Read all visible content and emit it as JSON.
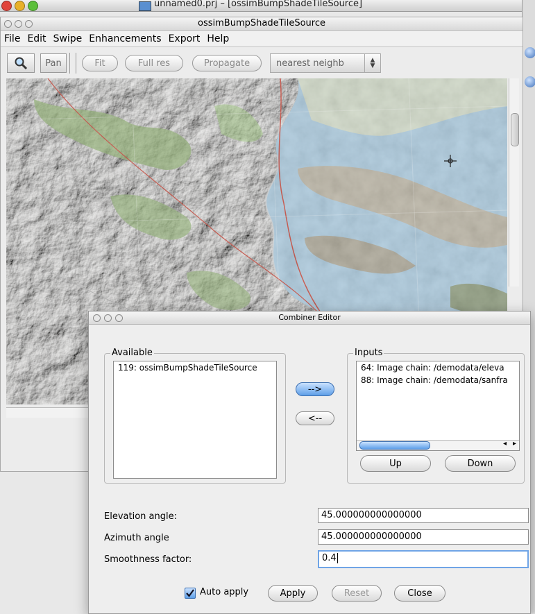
{
  "outer_window": {
    "title": "unnamed0.prj – [ossimBumpShadeTileSource]"
  },
  "main_window": {
    "title": "ossimBumpShadeTileSource",
    "menu": [
      "File",
      "Edit",
      "Swipe",
      "Enhancements",
      "Export",
      "Help"
    ],
    "toolbar": {
      "pan_label": "Pan",
      "fit_label": "Fit",
      "fullres_label": "Full res",
      "propagate_label": "Propagate",
      "resample_value": "nearest neighb"
    }
  },
  "dialog": {
    "title": "Combiner Editor",
    "available": {
      "label": "Available",
      "items": [
        "119: ossimBumpShadeTileSource"
      ]
    },
    "add_button": "-->",
    "remove_button": "<--",
    "inputs": {
      "label": "Inputs",
      "items": [
        "64: Image chain: /demodata/eleva",
        "88: Image chain: /demodata/sanfra"
      ]
    },
    "up_button": "Up",
    "down_button": "Down",
    "fields": [
      {
        "label": "Elevation angle:",
        "value": "45.000000000000000"
      },
      {
        "label": "Azimuth angle",
        "value": "45.000000000000000"
      },
      {
        "label": "Smoothness factor:",
        "value": "0.4"
      }
    ],
    "auto_apply_label": "Auto apply",
    "auto_apply_checked": true,
    "apply_button": "Apply",
    "reset_button": "Reset",
    "close_button": "Close"
  },
  "colors": {
    "accent_blue": "#5e9fe8",
    "water": "#a9c8dc",
    "land_green": "#9cc47d"
  }
}
